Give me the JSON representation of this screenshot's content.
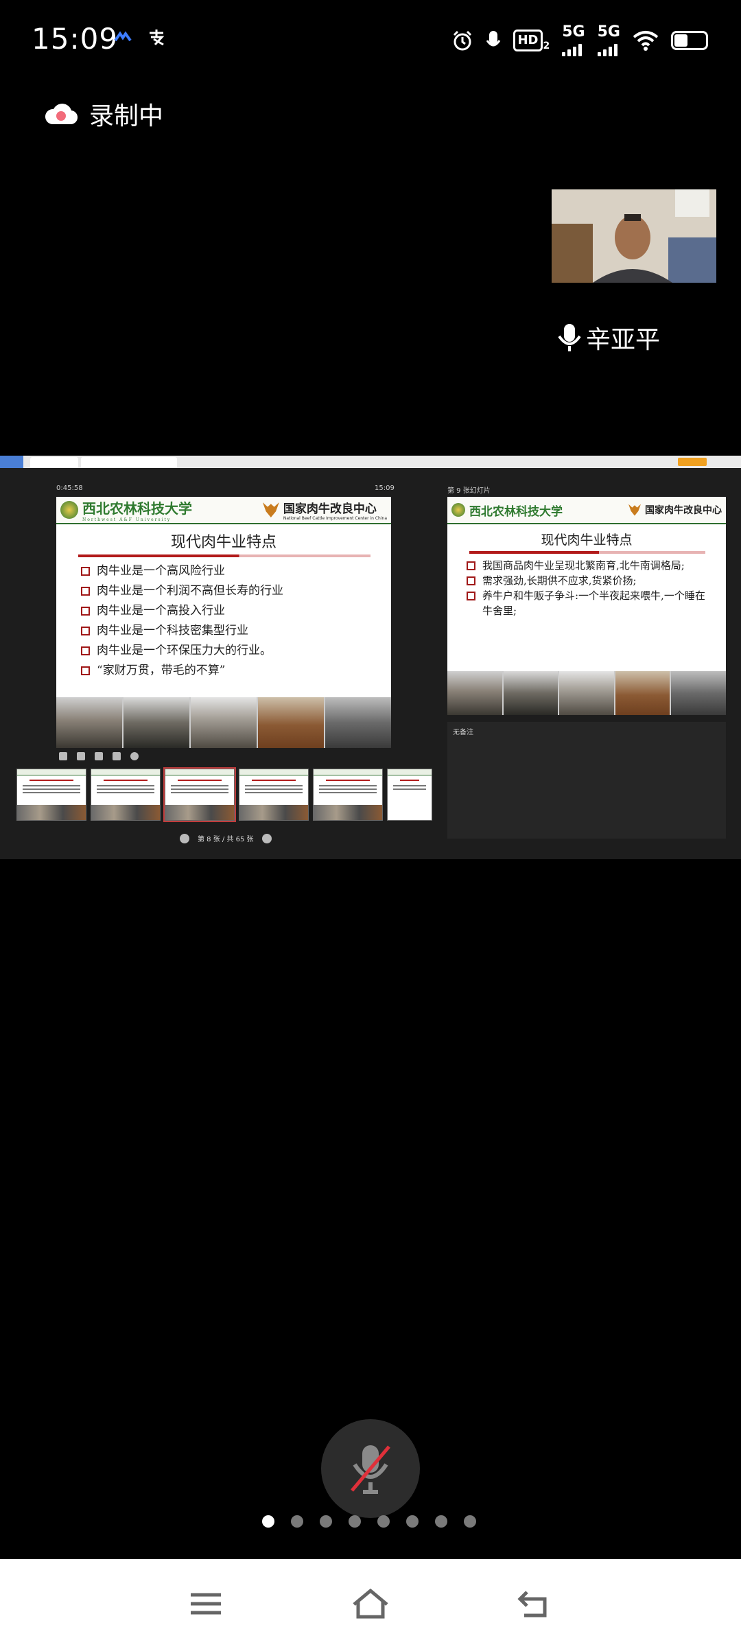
{
  "status_bar": {
    "time": "15:09",
    "hd_label": "HD",
    "hd_sub": "2",
    "net1": "5G",
    "net2": "5G"
  },
  "recording": {
    "label": "录制中"
  },
  "participant": {
    "name": "辛亚平"
  },
  "shared_screen": {
    "timer": "0:45:58",
    "clock": "15:09",
    "next_label": "第 9 张幻灯片",
    "notes_label": "无备注",
    "pager": "第 8 张 / 共 65 张",
    "current_slide": {
      "logo_left": "西北农林科技大学",
      "logo_left_en": "Northwest A&F University",
      "logo_right": "国家肉牛改良中心",
      "logo_right_en": "National Beef Cattle Improvement Center in China",
      "title": "现代肉牛业特点",
      "bullets": [
        "肉牛业是一个高风险行业",
        "肉牛业是一个利润不高但长寿的行业",
        "肉牛业是一个高投入行业",
        "肉牛业是一个科技密集型行业",
        "肉牛业是一个环保压力大的行业。",
        "“家财万贯，带毛的不算”"
      ]
    },
    "next_slide": {
      "title": "现代肉牛业特点",
      "bullets": [
        "我国商品肉牛业呈现北繁南育,北牛南调格局;",
        "需求强劲,长期供不应求,货紧价扬;",
        "养牛户和牛贩子争斗:一个半夜起来喂牛,一个睡在牛舍里;"
      ]
    }
  },
  "page_dots": {
    "count": 8,
    "active_index": 0
  },
  "colors": {
    "background": "#000000",
    "slide_red": "#b21b1b",
    "slide_green": "#2f7a2f"
  }
}
